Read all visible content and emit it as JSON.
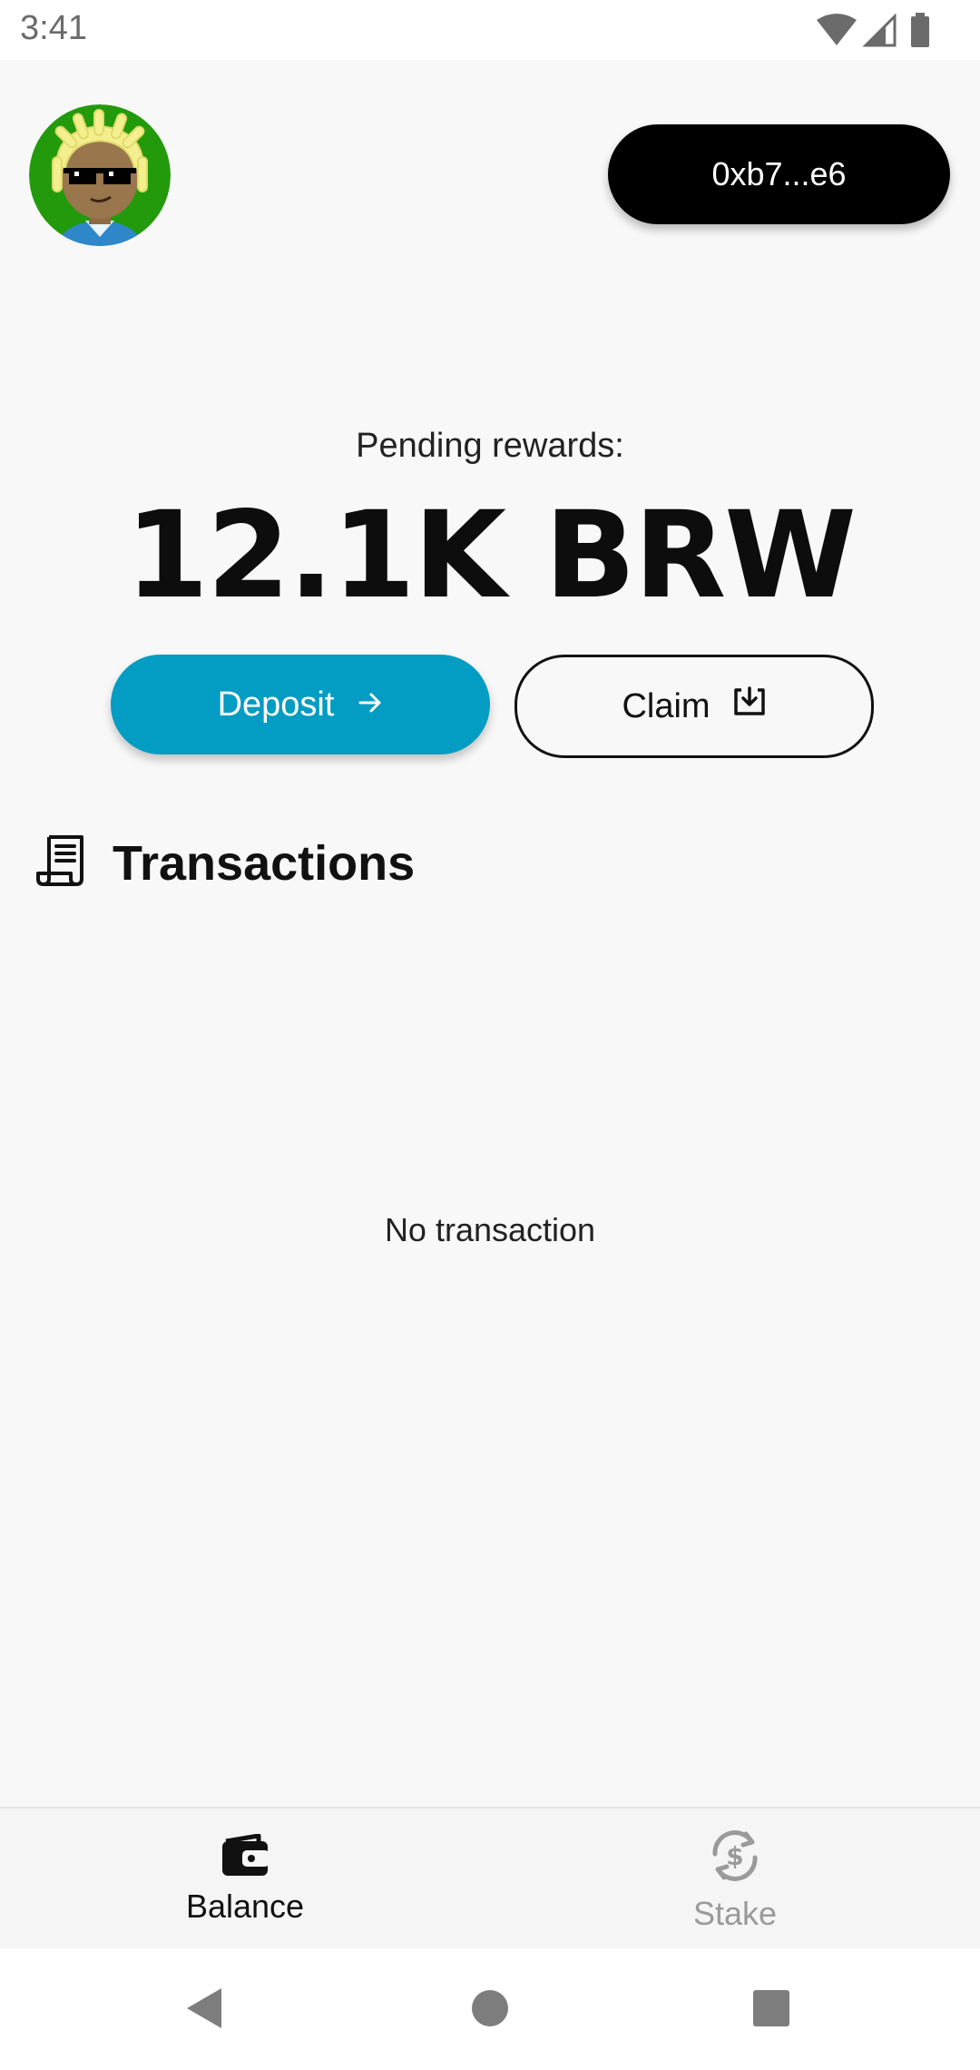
{
  "status": {
    "time": "3:41"
  },
  "header": {
    "wallet_address": "0xb7...e6"
  },
  "rewards": {
    "label": "Pending rewards:",
    "value": "12.1K BRW"
  },
  "actions": {
    "deposit_label": "Deposit",
    "claim_label": "Claim"
  },
  "transactions": {
    "title": "Transactions",
    "empty_text": "No transaction"
  },
  "bottom_nav": {
    "items": [
      {
        "label": "Balance",
        "icon": "wallet-icon",
        "active": true
      },
      {
        "label": "Stake",
        "icon": "stake-icon",
        "active": false
      }
    ]
  },
  "colors": {
    "accent": "#039cc2",
    "wallet_button": "#000000",
    "background": "#f8f8f8",
    "inactive": "#9a9a9a"
  }
}
